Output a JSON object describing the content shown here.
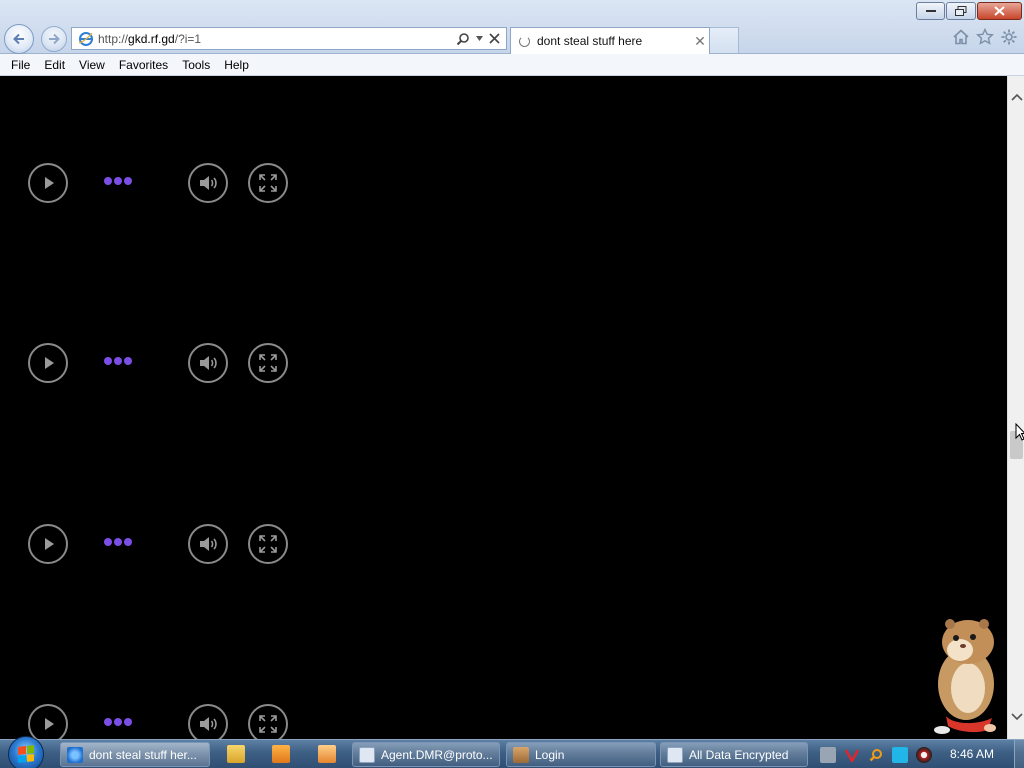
{
  "browser": {
    "address": {
      "scheme": "http://",
      "host": "gkd.rf.gd",
      "path": "/?i=1"
    },
    "tab": {
      "title": "dont steal stuff here"
    },
    "menu": [
      "File",
      "Edit",
      "View",
      "Favorites",
      "Tools",
      "Help"
    ],
    "icons": {
      "back": "back-arrow-icon",
      "forward": "forward-arrow-icon",
      "search": "search-icon",
      "stop": "close-icon",
      "home": "home-icon",
      "favorites": "star-icon",
      "tools": "gear-icon"
    }
  },
  "page": {
    "players": [
      {
        "id": 1
      },
      {
        "id": 2
      },
      {
        "id": 3
      },
      {
        "id": 4
      }
    ],
    "colors": {
      "background": "#000000",
      "loading_dots": "#7b4fe6",
      "control_ring": "#8a8a8a"
    }
  },
  "taskbar": {
    "items": [
      {
        "label": "dont steal stuff her...",
        "icon": "ie-icon",
        "active": true
      },
      {
        "label": "Agent.DMR@proto...",
        "icon": "window-icon",
        "active": false
      },
      {
        "label": "Login",
        "icon": "app-icon",
        "active": false
      },
      {
        "label": "All Data Encrypted",
        "icon": "window-icon",
        "active": false
      }
    ],
    "quick_launch": [
      "folder-icon",
      "media-player-icon",
      "app-icon"
    ],
    "clock": "8:46 AM"
  }
}
